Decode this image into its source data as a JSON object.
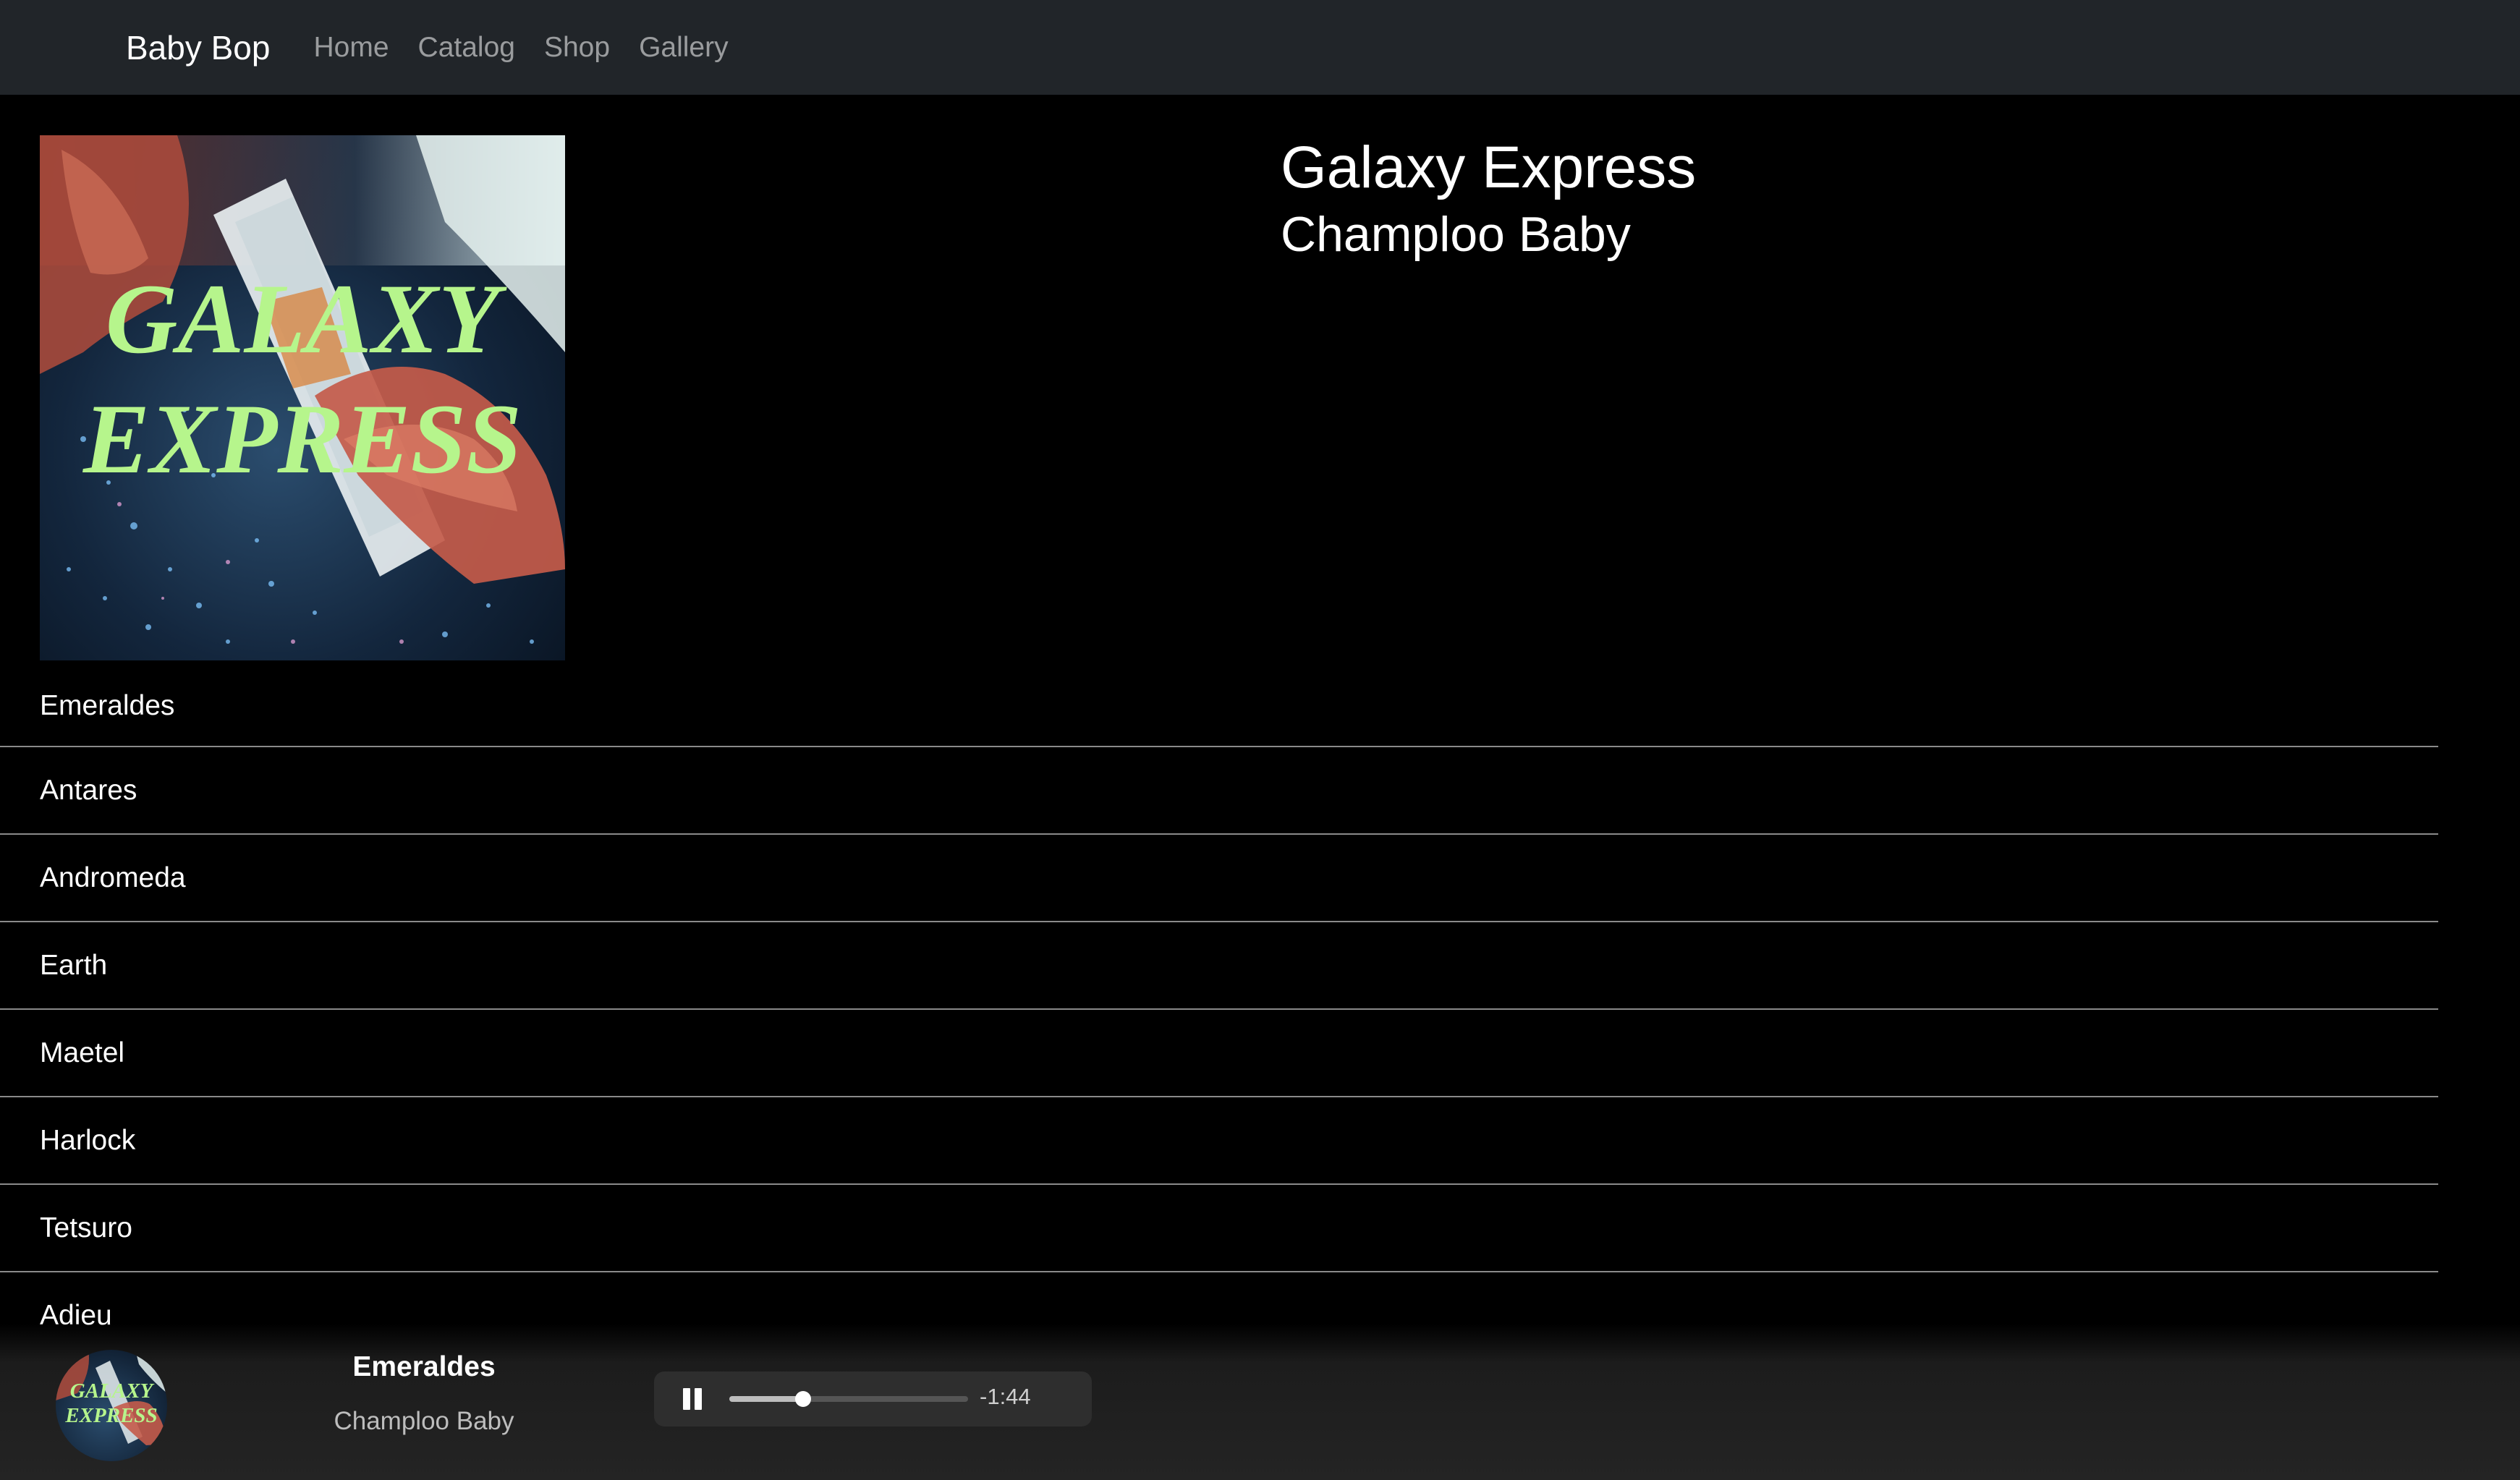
{
  "nav": {
    "brand": "Baby Bop",
    "links": [
      "Home",
      "Catalog",
      "Shop",
      "Gallery"
    ]
  },
  "album": {
    "title": "Galaxy Express",
    "artist": "Champloo Baby",
    "cover_text": [
      "GALAXY",
      "EXPRESS"
    ]
  },
  "tracks": [
    "Emeraldes",
    "Antares",
    "Andromeda",
    "Earth",
    "Maetel",
    "Harlock",
    "Tetsuro",
    "Adieu"
  ],
  "player": {
    "title": "Emeraldes",
    "artist": "Champloo Baby",
    "time_remaining": "-1:44",
    "progress": 0.31,
    "state": "playing",
    "button_icon": "pause-icon"
  },
  "colors": {
    "navbar_bg": "#212529",
    "page_bg": "#000000",
    "cover_text": "#b6f58c"
  }
}
